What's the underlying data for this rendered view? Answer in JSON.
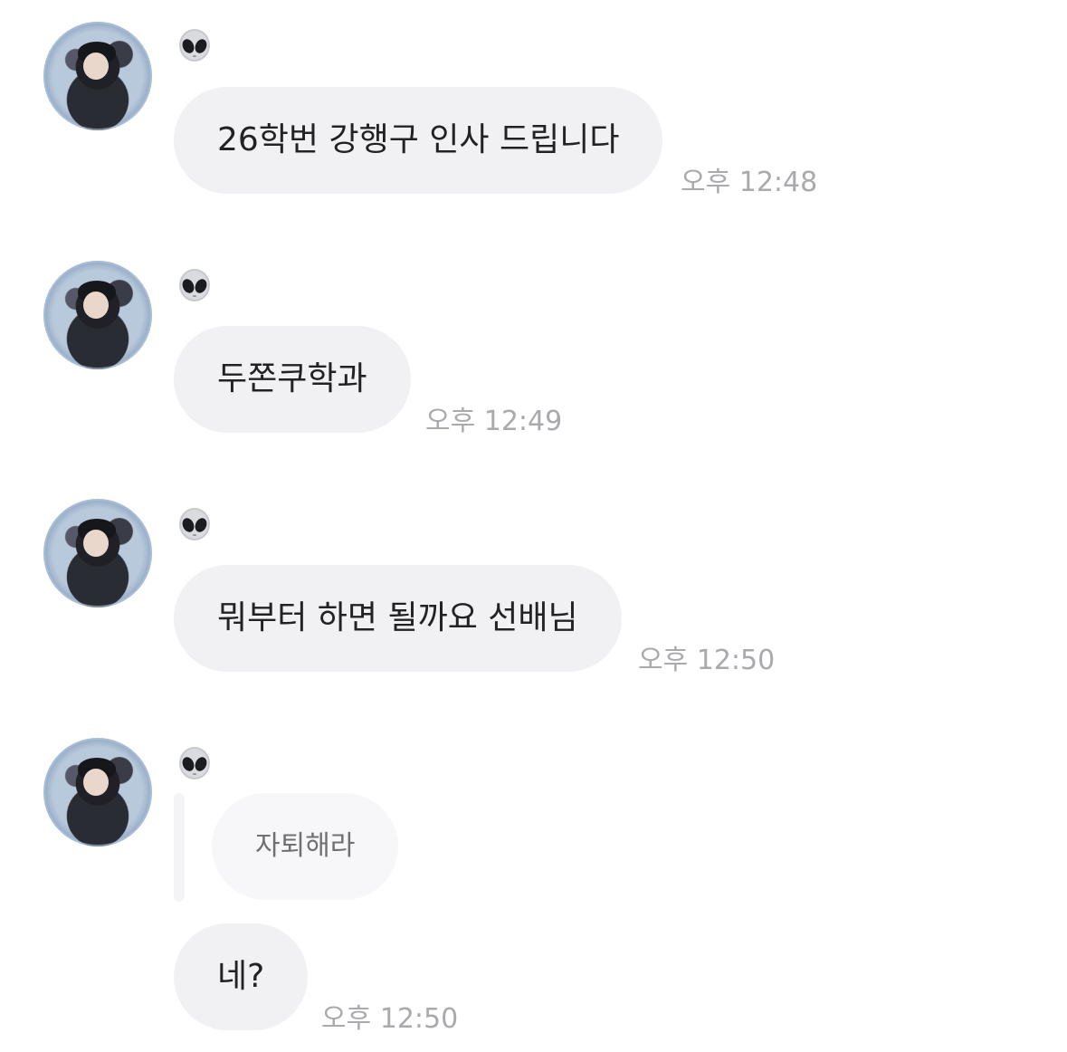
{
  "sender": {
    "name_icon": "alien-emoji"
  },
  "messages": [
    {
      "text": "26학번 강행구 인사 드립니다",
      "time": "오후 12:48"
    },
    {
      "text": "두쫀쿠학과",
      "time": "오후 12:49"
    },
    {
      "text": "뭐부터 하면 될까요 선배님",
      "time": "오후 12:50"
    },
    {
      "quoted": "자퇴해라",
      "text": "네?",
      "time": "오후 12:50"
    }
  ]
}
